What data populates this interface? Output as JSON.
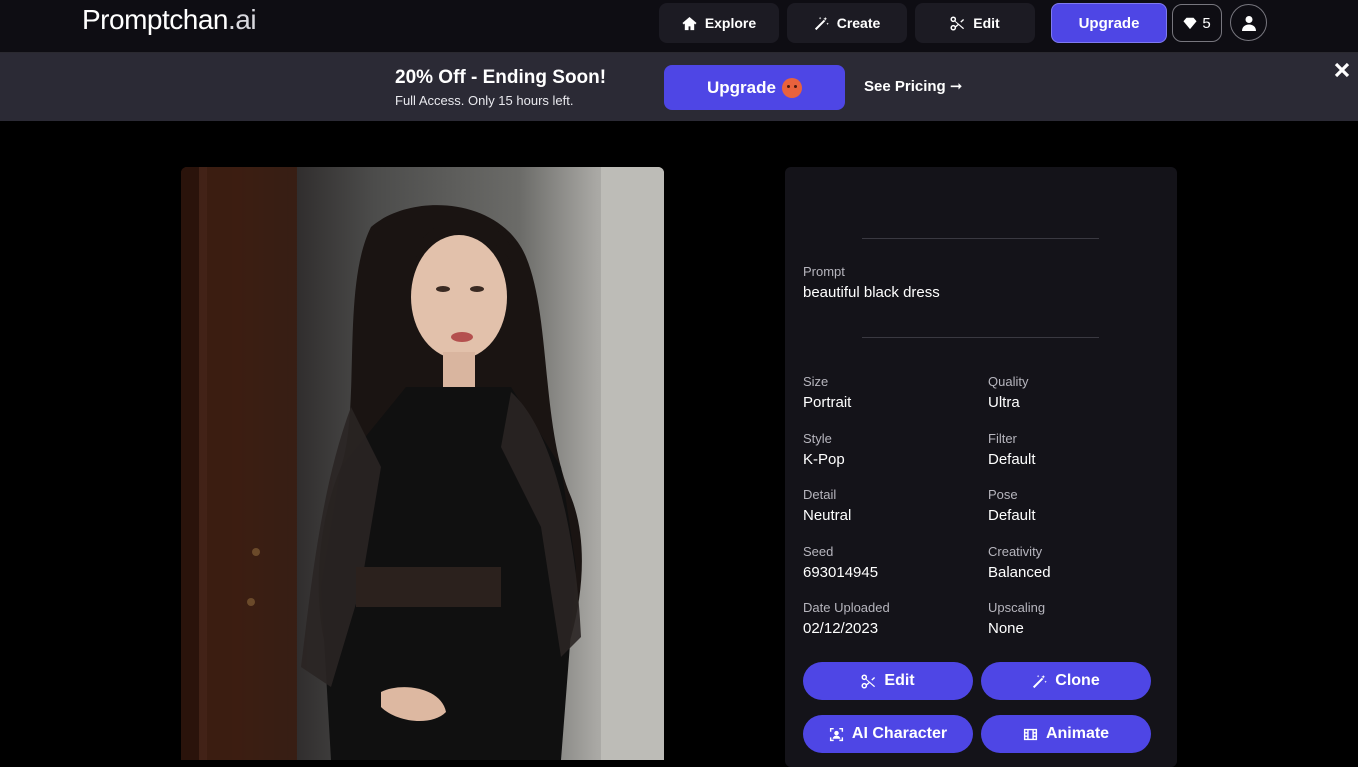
{
  "nav": {
    "logo_main": "Promptchan",
    "logo_suffix": ".ai",
    "explore_label": "Explore",
    "create_label": "Create",
    "edit_label": "Edit",
    "upgrade_label": "Upgrade",
    "gem_count": "5",
    "icons": [
      "home-icon",
      "magic-wand-icon",
      "scissors-icon",
      "gem-icon",
      "user-icon"
    ]
  },
  "banner": {
    "title": "20% Off - Ending Soon!",
    "subtitle": "Full Access. Only 15 hours left.",
    "upgrade_label": "Upgrade",
    "see_pricing_label": "See Pricing ➞",
    "icons": [
      "hot-face-emoji",
      "close-icon"
    ]
  },
  "details": {
    "prompt_label": "Prompt",
    "prompt_value": "beautiful black dress",
    "fields": [
      {
        "label": "Size",
        "value": "Portrait"
      },
      {
        "label": "Quality",
        "value": "Ultra"
      },
      {
        "label": "Style",
        "value": "K-Pop"
      },
      {
        "label": "Filter",
        "value": "Default"
      },
      {
        "label": "Detail",
        "value": "Neutral"
      },
      {
        "label": "Pose",
        "value": "Default"
      },
      {
        "label": "Seed",
        "value": "693014945"
      },
      {
        "label": "Creativity",
        "value": "Balanced"
      },
      {
        "label": "Date Uploaded",
        "value": "02/12/2023"
      },
      {
        "label": "Upscaling",
        "value": "None"
      }
    ],
    "actions": {
      "edit_label": "Edit",
      "clone_label": "Clone",
      "ai_character_label": "AI Character",
      "animate_label": "Animate"
    }
  },
  "colors": {
    "accent": "#4e46e5",
    "background": "#000000",
    "card": "#141319",
    "nav": "#0e0d13",
    "banner": "#2b2a35"
  }
}
